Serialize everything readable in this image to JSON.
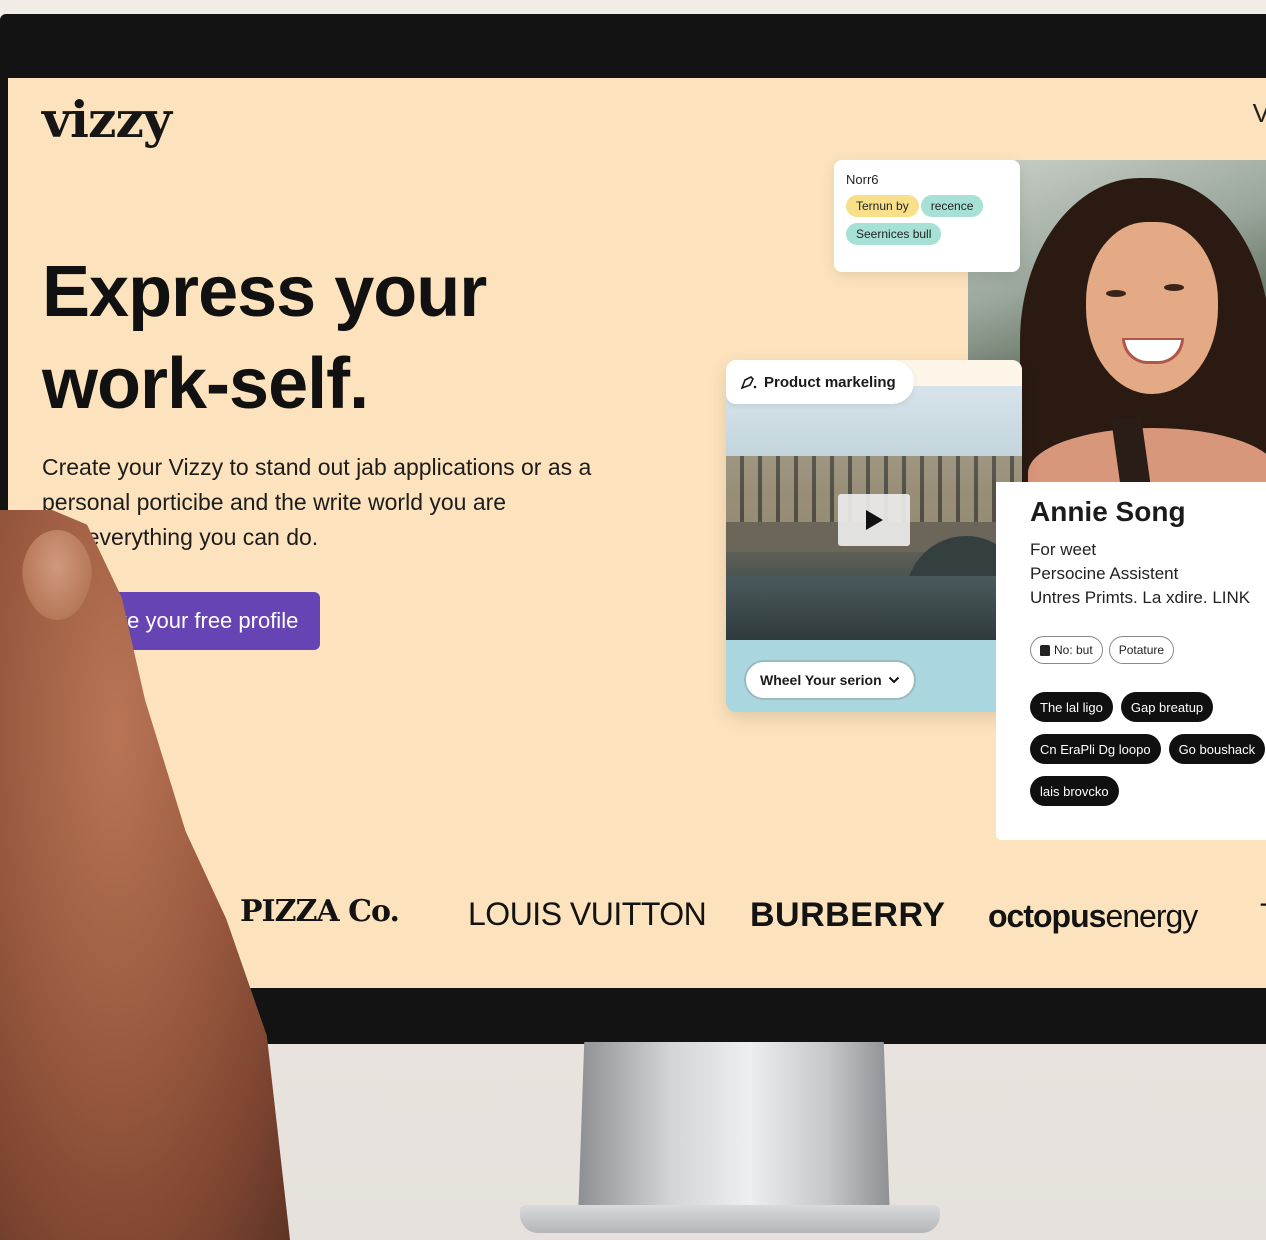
{
  "site": {
    "logo": "vizzy",
    "nav_cut": "V"
  },
  "hero": {
    "title_line1": "Express your",
    "title_line2": "work-self.",
    "subtitle_line1": "Create your Vizzy to stand out jab applications or as a",
    "subtitle_line2": "personal porticibe and the write world you are",
    "subtitle_line3": "und everything you can do.",
    "cta_label": "calke your free profile"
  },
  "tag_card": {
    "title": "Norr6",
    "pills": [
      "Ternun by",
      "recence",
      "Seernices bull"
    ]
  },
  "video_card": {
    "chip_label": "Product markeling",
    "select_label": "Wheel Your serion"
  },
  "profile": {
    "name": "Annie Song",
    "line1": "For weet",
    "line2": "Persocine Assistent",
    "line3": "Untres Primts. La xdire. LINK",
    "outline_pills": [
      "No: but",
      "Potature"
    ],
    "dark_pills": [
      "The lal ligo",
      "Gap breatup",
      "Cn EraPli Dg loopo",
      "Go boushack",
      "lais brovcko"
    ]
  },
  "brands": {
    "pizza": "PIZZA Co.",
    "lv": "LOUIS VUITTON",
    "burberry": "BURBERRY",
    "octopus_bold": "octopus",
    "octopus_light": "energy",
    "cut": "T"
  },
  "colors": {
    "screen_bg": "#fde3bd",
    "cta_bg": "#6644b3",
    "pill_yellow": "#f7e089",
    "pill_teal": "#a7e0d5"
  }
}
